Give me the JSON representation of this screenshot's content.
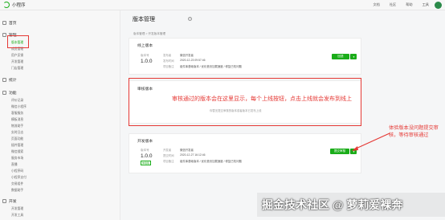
{
  "app": {
    "title": "小程序"
  },
  "topnav": {
    "items": [
      "文档",
      "社区",
      "帮助",
      "工具"
    ]
  },
  "sidebar": {
    "groups": [
      {
        "label": "首页",
        "items": []
      },
      {
        "label": "管理",
        "items": [
          "版本管理",
          "成员管理",
          "用户反馈",
          "开发管理",
          "门店管理"
        ]
      },
      {
        "label": "统计",
        "items": []
      },
      {
        "label": "功能",
        "items": [
          "评价记录",
          "微信小程序",
          "客服服务",
          "模板消息",
          "物流助手",
          "实时日志",
          "页面功能",
          "插件管理",
          "微信搜索",
          "服务市场",
          "直播",
          "小程序码",
          "小程序支付",
          "交易组件",
          "数据助手"
        ]
      },
      {
        "label": "开发",
        "items": [
          "开发管理",
          "开发工具"
        ]
      }
    ]
  },
  "page": {
    "title": "版本管理",
    "help": "?",
    "breadcrumb": "版本管理 > 开发版本管理"
  },
  "online": {
    "title": "线上版本",
    "version_label": "版本号",
    "version": "1.0.0",
    "meta": [
      [
        "发布者",
        "微信开发者"
      ],
      [
        "发布时间",
        "2020-12-23 09:57:46"
      ],
      [
        "项目备注",
        "组件库基础版本 / 优化首页加载速度 / 修复已知问题"
      ]
    ],
    "btn": "回退",
    "drop": "▾"
  },
  "review": {
    "title": "审核版本",
    "empty": "你暂无提交审核的版本或者版本已发布上线"
  },
  "dev": {
    "title": "开发版本",
    "version_label": "版本号",
    "version": "1.0.0",
    "tag": "体验版",
    "meta": [
      [
        "开发者",
        "微信开发者"
      ],
      [
        "提交时间",
        "2020-12-27 16:12:46"
      ],
      [
        "项目备注",
        "组件库基础版本 / 优化首页加载速度 / 修复已知问题"
      ]
    ],
    "btn": "提交审核",
    "drop": "▾"
  },
  "annotations": {
    "review_note": "审核通过的版本会在这里显示，每个上线按钮，点击上线就会发布到线上",
    "dev_note": "体验版本没问题提交审核，等待审核通过",
    "color": "#e53935"
  },
  "watermark": "掘金技术社区 @ 萝莉爱裸奔",
  "colors": {
    "accent": "#1aad19"
  }
}
